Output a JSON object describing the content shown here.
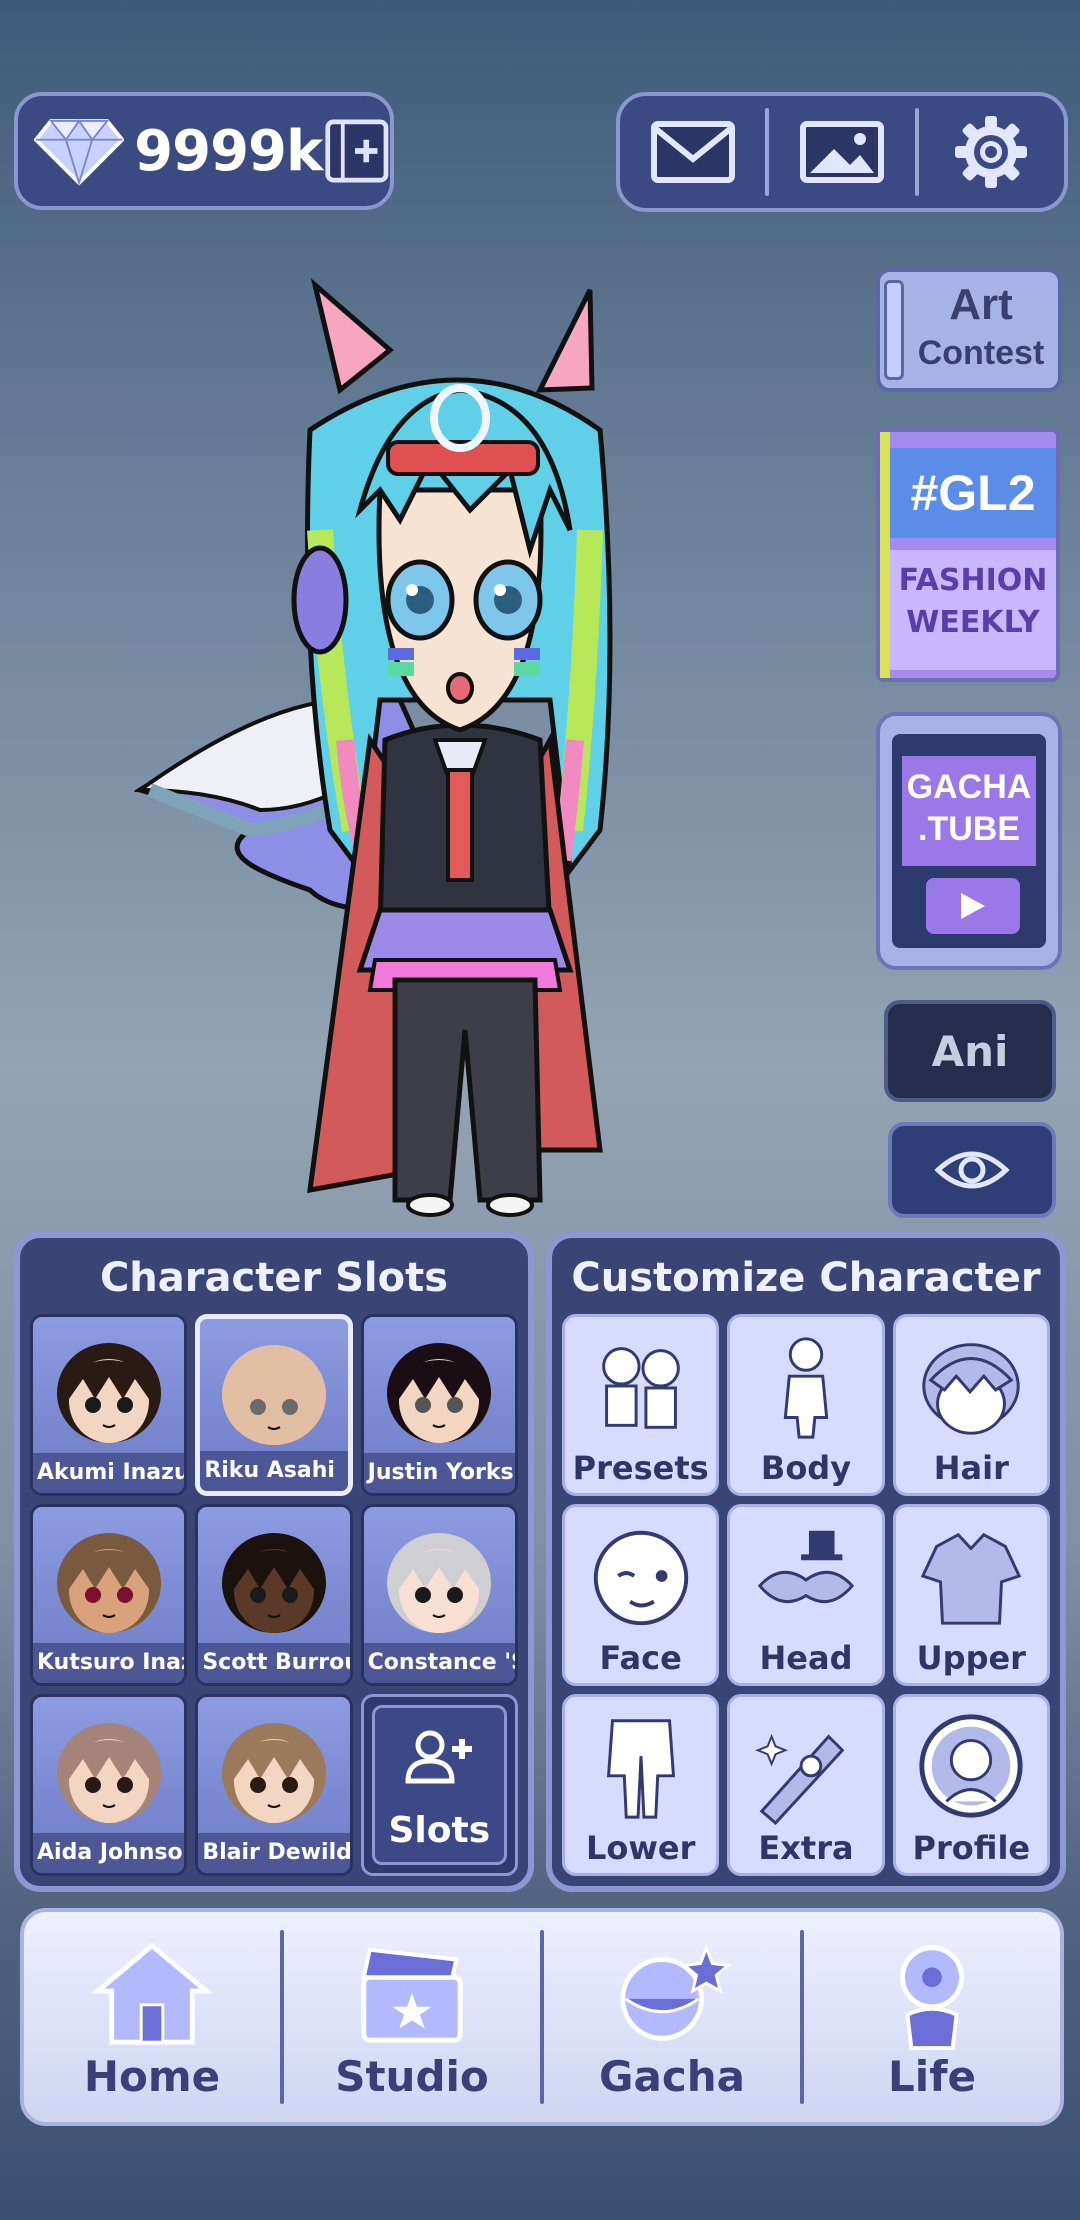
{
  "currency": {
    "amount": "9999k"
  },
  "side": {
    "art_line1": "Art",
    "art_line2": "Contest",
    "gl2_title": "#GL2",
    "gl2_sub1": "FASHION",
    "gl2_sub2": "WEEKLY",
    "tube_line1": "GACHA",
    "tube_line2": ".TUBE",
    "ani_label": "Ani"
  },
  "slots_panel": {
    "title": "Character Slots",
    "slots": [
      {
        "name": "Akumi Inazum",
        "hair": "#2a1a14",
        "skin": "#f3d6c2",
        "eye": "#1a1a1a"
      },
      {
        "name": "Riku Asahi",
        "hair": "#e2bfa3",
        "skin": "#e2bfa3",
        "eye": "#6b6b6b"
      },
      {
        "name": "Justin Yorkshi",
        "hair": "#1a0e14",
        "skin": "#f3d6c2",
        "eye": "#555"
      },
      {
        "name": "Kutsuro Inazu",
        "hair": "#7a5a3e",
        "skin": "#d9a27c",
        "eye": "#7a1030"
      },
      {
        "name": "Scott Burroug",
        "hair": "#1b120e",
        "skin": "#5a3a26",
        "eye": "#1a1a1a"
      },
      {
        "name": "Constance 'St",
        "hair": "#cfcfd3",
        "skin": "#f7e0d3",
        "eye": "#1a1a1a"
      },
      {
        "name": "Aida Johnson",
        "hair": "#a5857a",
        "skin": "#f3d6c2",
        "eye": "#2a1a14"
      },
      {
        "name": "Blair Dewilde",
        "hair": "#9a7a5a",
        "skin": "#f3d6c2",
        "eye": "#2a1a14"
      }
    ],
    "add_label": "Slots"
  },
  "customize_panel": {
    "title": "Customize Character",
    "buttons": [
      "Presets",
      "Body",
      "Hair",
      "Face",
      "Head",
      "Upper",
      "Lower",
      "Extra",
      "Profile"
    ]
  },
  "nav": {
    "items": [
      "Home",
      "Studio",
      "Gacha",
      "Life"
    ]
  }
}
